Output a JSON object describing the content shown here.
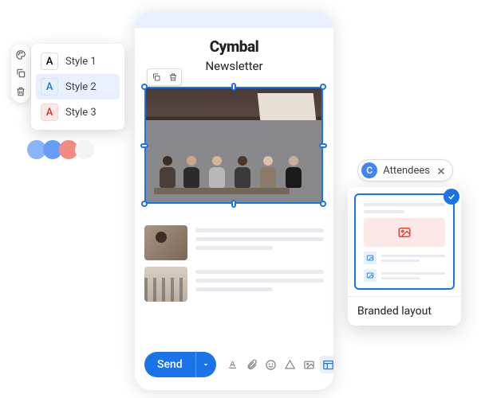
{
  "editor": {
    "brand": "Cymbal",
    "subtitle": "Newsletter",
    "selection_tools": {
      "copy": "copy",
      "delete": "delete"
    }
  },
  "compose": {
    "send_label": "Send"
  },
  "style_picker": {
    "items": [
      {
        "letter": "A",
        "label": "Style 1",
        "variant": "default",
        "selected": false
      },
      {
        "letter": "A",
        "label": "Style 2",
        "variant": "blue",
        "selected": true
      },
      {
        "letter": "A",
        "label": "Style 3",
        "variant": "red",
        "selected": false
      }
    ]
  },
  "side_tools": [
    "palette",
    "copy",
    "delete"
  ],
  "swatches": [
    "#8ab4f8",
    "#669df6",
    "#f28b82",
    "#f1f3f4"
  ],
  "chip": {
    "initial": "C",
    "label": "Attendees"
  },
  "layout_card": {
    "label": "Branded layout",
    "selected": true
  }
}
